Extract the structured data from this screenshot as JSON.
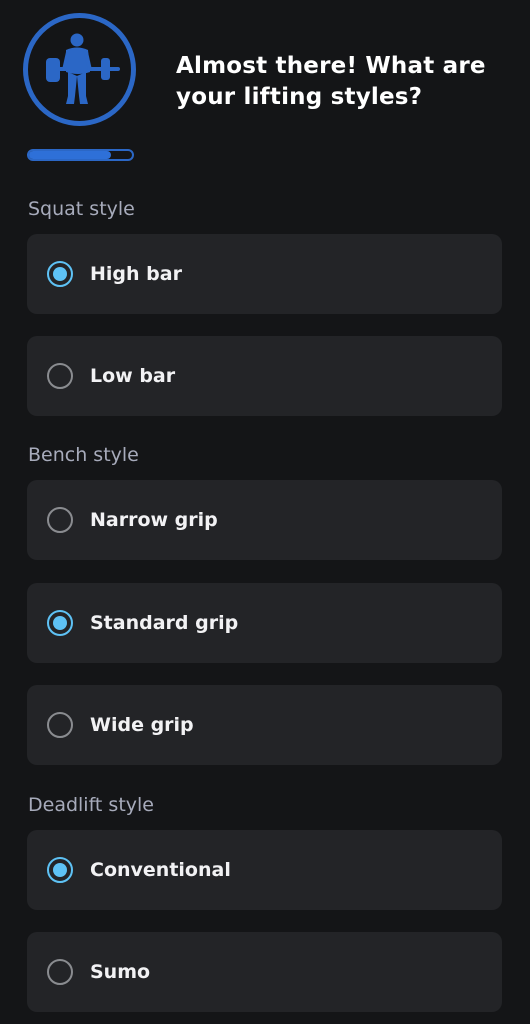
{
  "header": {
    "title": "Almost there! What are your lifting styles?",
    "logo_icon": "weightlifter-icon",
    "accent_color": "#2b67c6"
  },
  "progress": {
    "fraction": 0.8
  },
  "colors": {
    "background": "#141517",
    "card": "#232427",
    "selected_radio": "#5ec2f5",
    "section_label": "#a7abbb"
  },
  "sections": [
    {
      "label": "Squat style",
      "options": [
        {
          "label": "High bar",
          "selected": true
        },
        {
          "label": "Low bar",
          "selected": false
        }
      ]
    },
    {
      "label": "Bench style",
      "options": [
        {
          "label": "Narrow grip",
          "selected": false
        },
        {
          "label": "Standard grip",
          "selected": true
        },
        {
          "label": "Wide grip",
          "selected": false
        }
      ]
    },
    {
      "label": "Deadlift style",
      "options": [
        {
          "label": "Conventional",
          "selected": true
        },
        {
          "label": "Sumo",
          "selected": false
        }
      ]
    }
  ]
}
